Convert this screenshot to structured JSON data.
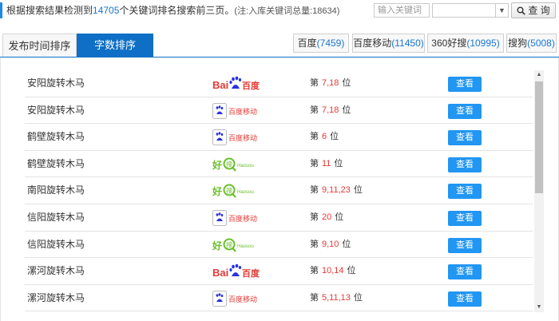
{
  "header": {
    "summary_prefix": "根据搜索结果检测到",
    "keyword_count": "14705",
    "summary_suffix": "个关键词排名搜索前三页。",
    "note": "(注:入库关键词总量:18634)"
  },
  "search": {
    "placeholder": "输入关键词",
    "select_value": "",
    "button_label": "查 询"
  },
  "tabs": [
    {
      "label": "发布时间排序",
      "active": false
    },
    {
      "label": "字数排序",
      "active": true
    }
  ],
  "engines": [
    {
      "name": "百度",
      "count": "(7459)"
    },
    {
      "name": "百度移动",
      "count": "(11450)"
    },
    {
      "name": "360好搜",
      "count": "(10995)"
    },
    {
      "name": "搜狗",
      "count": "(5008)"
    }
  ],
  "rank_prefix": "第",
  "rank_suffix": "位",
  "view_label": "查看",
  "logos": {
    "baidu": {
      "text_left": "Bai",
      "text_right": "百度",
      "color_left": "#e53935",
      "color_right": "#e53935",
      "paw_color": "#2932e1"
    },
    "baidu_mobile": {
      "text": "百度移动",
      "color": "#e53935",
      "icon_color": "#2932e1"
    },
    "haosou": {
      "text_main": "好",
      "text_sub": "搜",
      "text_en": "Haosou",
      "color": "#6abf2a"
    }
  },
  "rows": [
    {
      "keyword": "安阳旋转木马",
      "engine": "baidu",
      "rank": "7,18"
    },
    {
      "keyword": "安阳旋转木马",
      "engine": "baidu_mobile",
      "rank": "7,18"
    },
    {
      "keyword": "鹤壁旋转木马",
      "engine": "baidu_mobile",
      "rank": "6"
    },
    {
      "keyword": "鹤壁旋转木马",
      "engine": "haosou",
      "rank": "11"
    },
    {
      "keyword": "南阳旋转木马",
      "engine": "haosou",
      "rank": "9,11,23"
    },
    {
      "keyword": "信阳旋转木马",
      "engine": "baidu_mobile",
      "rank": "20"
    },
    {
      "keyword": "信阳旋转木马",
      "engine": "haosou",
      "rank": "9,10"
    },
    {
      "keyword": "漯河旋转木马",
      "engine": "baidu",
      "rank": "10,14"
    },
    {
      "keyword": "漯河旋转木马",
      "engine": "baidu_mobile",
      "rank": "5,11,13"
    }
  ],
  "colors": {
    "accent": "#0f6fc6",
    "link_blue": "#1976d2",
    "rank_red": "#e53935",
    "button_blue": "#2196f3"
  }
}
